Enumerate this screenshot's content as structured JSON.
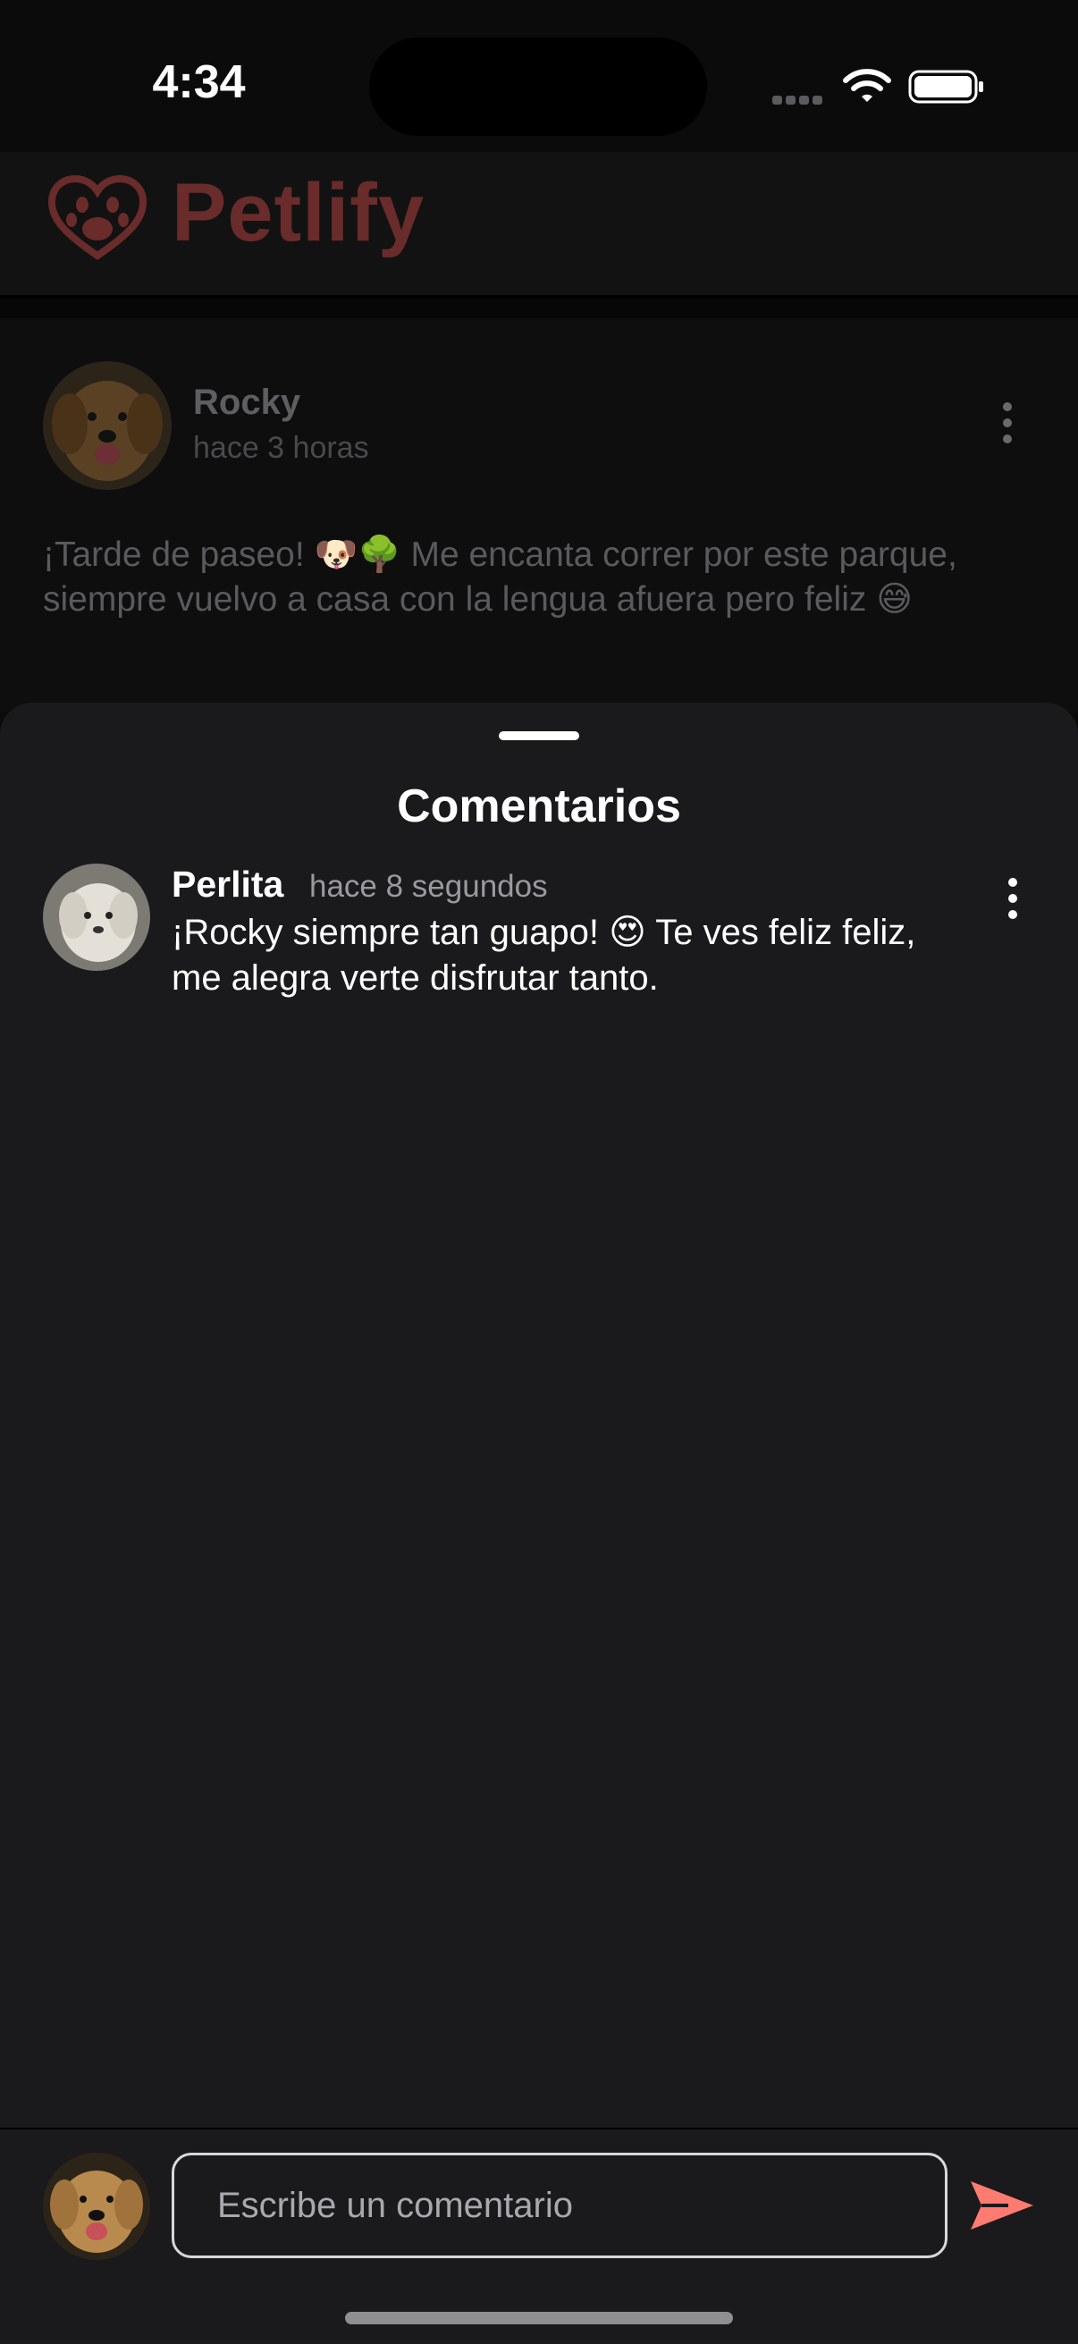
{
  "status_bar": {
    "time": "4:34"
  },
  "header": {
    "app_title": "Petlify",
    "brand_color": "#6a2b2b"
  },
  "post": {
    "author": "Rocky",
    "time_ago": "hace 3 horas",
    "text": "¡Tarde de paseo! 🐶🌳 Me encanta correr por este parque, siempre vuelvo a casa con la lengua afuera pero feliz 😅",
    "avatar": "golden-retriever-avatar"
  },
  "comments_sheet": {
    "title": "Comentarios",
    "comments": [
      {
        "author": "Perlita",
        "time_ago": "hace 8 segundos",
        "text": "¡Rocky siempre tan guapo! 😍 Te ves feliz feliz, me alegra verte disfrutar tanto.",
        "avatar": "white-poodle-avatar"
      }
    ]
  },
  "composer": {
    "placeholder": "Escribe un comentario",
    "value": "",
    "send_icon": "send-icon",
    "send_color": "#ff7b72"
  }
}
